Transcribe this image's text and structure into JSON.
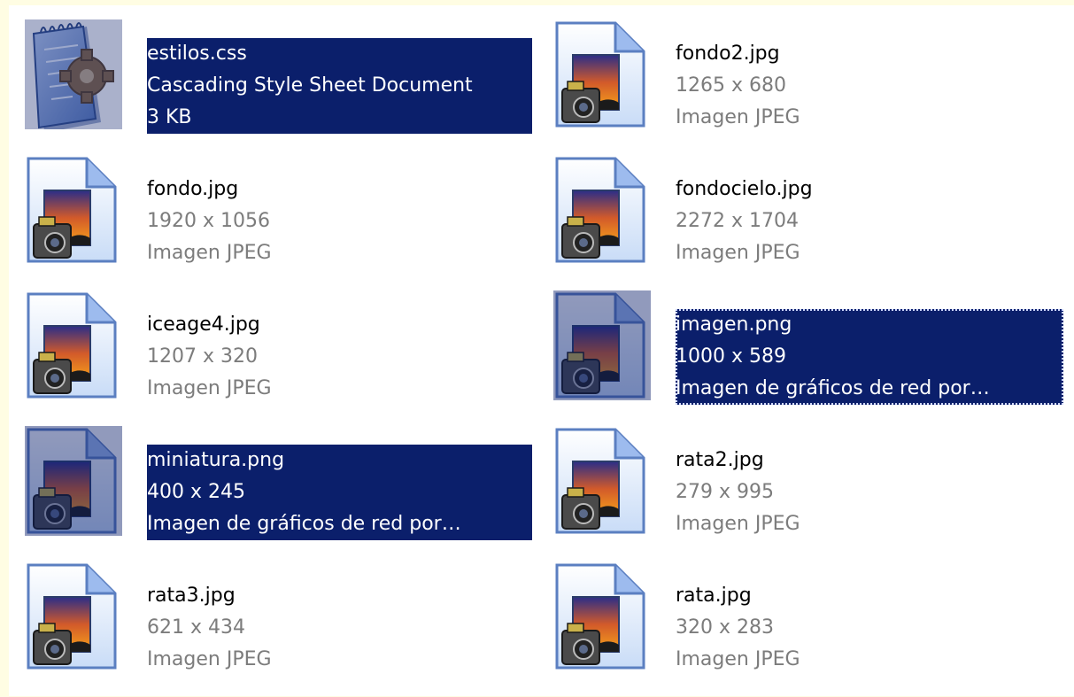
{
  "files": [
    {
      "name": "estilos.css",
      "line2": "Cascading Style Sheet Document",
      "line3": "3 KB",
      "icon": "css-document-icon",
      "selected": true
    },
    {
      "name": "fondo2.jpg",
      "line2": "1265 x 680",
      "line3": "Imagen JPEG",
      "icon": "jpeg-image-icon",
      "selected": false
    },
    {
      "name": "fondo.jpg",
      "line2": "1920 x 1056",
      "line3": "Imagen JPEG",
      "icon": "jpeg-image-icon",
      "selected": false
    },
    {
      "name": "fondocielo.jpg",
      "line2": "2272 x 1704",
      "line3": "Imagen JPEG",
      "icon": "jpeg-image-icon",
      "selected": false
    },
    {
      "name": "iceage4.jpg",
      "line2": "1207 x 320",
      "line3": "Imagen JPEG",
      "icon": "jpeg-image-icon",
      "selected": false
    },
    {
      "name": "imagen.png",
      "line2": "1000 x 589",
      "line3": "Imagen de gráficos de red por…",
      "icon": "png-image-icon",
      "selected": true,
      "focused": true
    },
    {
      "name": "miniatura.png",
      "line2": "400 x 245",
      "line3": "Imagen de gráficos de red por…",
      "icon": "png-image-icon",
      "selected": true
    },
    {
      "name": "rata2.jpg",
      "line2": "279 x 995",
      "line3": "Imagen JPEG",
      "icon": "jpeg-image-icon",
      "selected": false
    },
    {
      "name": "rata3.jpg",
      "line2": "621 x 434",
      "line3": "Imagen JPEG",
      "icon": "jpeg-image-icon",
      "selected": false
    },
    {
      "name": "rata.jpg",
      "line2": "320 x 283",
      "line3": "Imagen JPEG",
      "icon": "jpeg-image-icon",
      "selected": false
    }
  ],
  "colors": {
    "selection": "#0b1f6b",
    "window_frame": "#fffde3",
    "secondary_text": "#7c7c7c"
  }
}
